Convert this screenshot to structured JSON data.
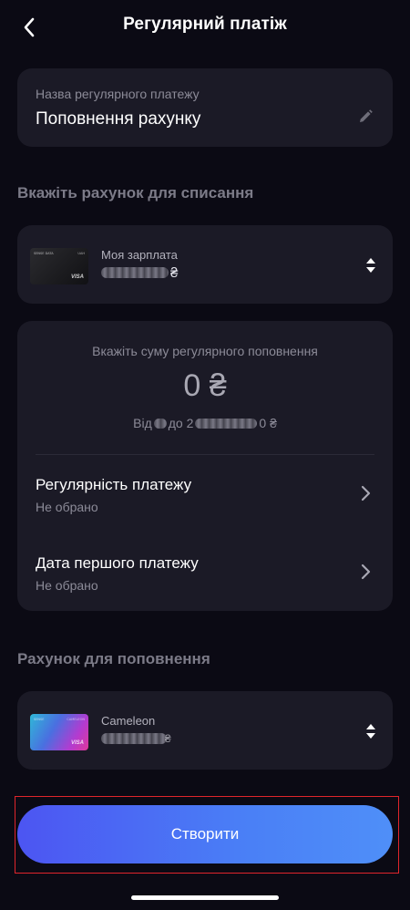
{
  "header": {
    "title": "Регулярний платіж"
  },
  "name_field": {
    "label": "Назва регулярного платежу",
    "value": "Поповнення рахунку"
  },
  "debit_section": {
    "title": "Вкажіть рахунок для списання",
    "account": {
      "card_thumb_text_left": "SENSE DATA",
      "card_thumb_text_right": "UAH",
      "card_network": "VISA",
      "name": "Моя зарплата",
      "balance_currency": "₴"
    }
  },
  "amount_section": {
    "label": "Вкажіть суму регулярного поповнення",
    "amount": "0 ₴",
    "range_from": "Від",
    "range_to": "до 2",
    "range_end": "0 ₴"
  },
  "options": [
    {
      "title": "Регулярність платежу",
      "value": "Не обрано"
    },
    {
      "title": "Дата першого платежу",
      "value": "Не обрано"
    }
  ],
  "credit_section": {
    "title": "Рахунок для поповнення",
    "account": {
      "card_thumb_text_left": "SENSE",
      "card_thumb_text_right": "CAMELEON",
      "card_network": "VISA",
      "name": "Cameleon",
      "balance_currency": "₴"
    }
  },
  "create_button": {
    "label": "Створити"
  },
  "colors": {
    "background": "#0b0a14",
    "card": "#1b1a26",
    "accent_start": "#4c55f2",
    "accent_end": "#4f8ff8",
    "highlight_border": "#e0252b"
  }
}
